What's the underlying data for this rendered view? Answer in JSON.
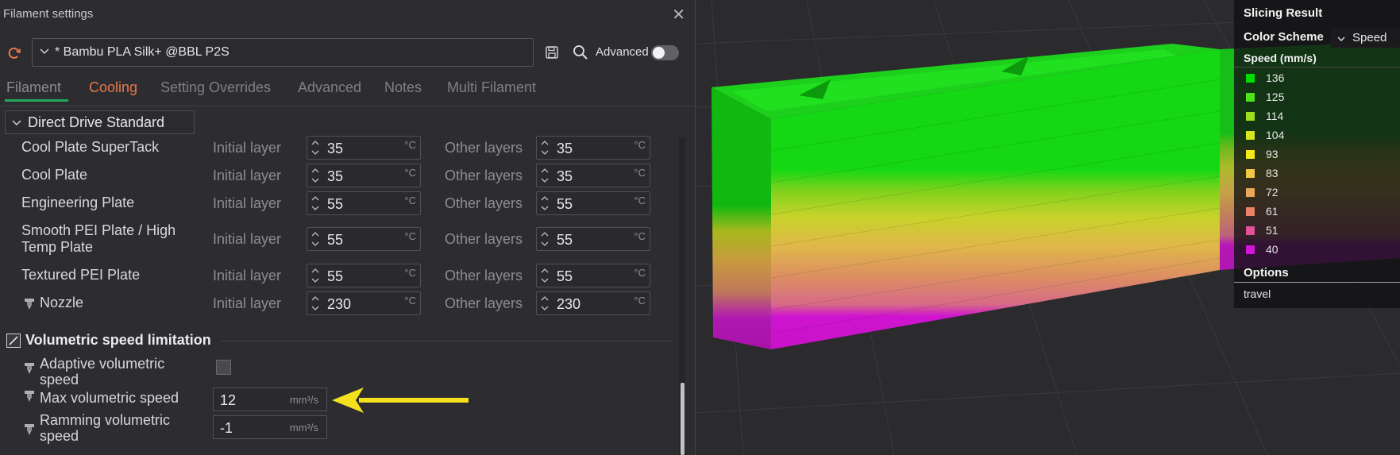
{
  "dialog": {
    "title": "Filament settings",
    "preset": "* Bambu PLA Silk+ @BBL P2S",
    "advanced_label": "Advanced",
    "advanced_on": false
  },
  "tabs": [
    {
      "label": "Filament",
      "active": true
    },
    {
      "label": "Cooling"
    },
    {
      "label": "Setting Overrides"
    },
    {
      "label": "Advanced"
    },
    {
      "label": "Notes"
    },
    {
      "label": "Multi Filament"
    }
  ],
  "extruder_section": "Direct Drive Standard",
  "temps": {
    "initial_label": "Initial layer",
    "other_label": "Other layers",
    "unit": "°C",
    "rows": [
      {
        "label": "Cool Plate SuperTack",
        "initial": "35",
        "other": "35"
      },
      {
        "label": "Cool Plate",
        "initial": "35",
        "other": "35"
      },
      {
        "label": "Engineering Plate",
        "initial": "55",
        "other": "55"
      },
      {
        "label": "Smooth PEI Plate / High Temp Plate",
        "initial": "55",
        "other": "55"
      },
      {
        "label": "Textured PEI Plate",
        "initial": "55",
        "other": "55"
      },
      {
        "label": "Nozzle",
        "initial": "230",
        "other": "230"
      }
    ]
  },
  "volumetric": {
    "title": "Volumetric speed limitation",
    "adaptive_label": "Adaptive volumetric speed",
    "adaptive_checked": false,
    "max_label": "Max volumetric speed",
    "max_value": "12",
    "ramming_label": "Ramming volumetric speed",
    "ramming_value": "-1",
    "unit": "mm³/s"
  },
  "legend": {
    "title": "Slicing Result",
    "scheme_label": "Color Scheme",
    "scheme_value": "Speed",
    "speed_header": "Speed (mm/s)",
    "items": [
      {
        "value": "136",
        "color": "#00e000"
      },
      {
        "value": "125",
        "color": "#4ee41a"
      },
      {
        "value": "114",
        "color": "#9de01c"
      },
      {
        "value": "104",
        "color": "#d7e51e"
      },
      {
        "value": "93",
        "color": "#f4ea17"
      },
      {
        "value": "83",
        "color": "#f2c744"
      },
      {
        "value": "72",
        "color": "#eda65a"
      },
      {
        "value": "61",
        "color": "#e98269"
      },
      {
        "value": "51",
        "color": "#e64f9a"
      },
      {
        "value": "40",
        "color": "#d316d9"
      }
    ],
    "options_header": "Options",
    "travel_label": "travel"
  },
  "colors": {
    "accent_green": "#1fa75a",
    "cooling_tab": "#e8774a",
    "arrow": "#f4e01c"
  }
}
